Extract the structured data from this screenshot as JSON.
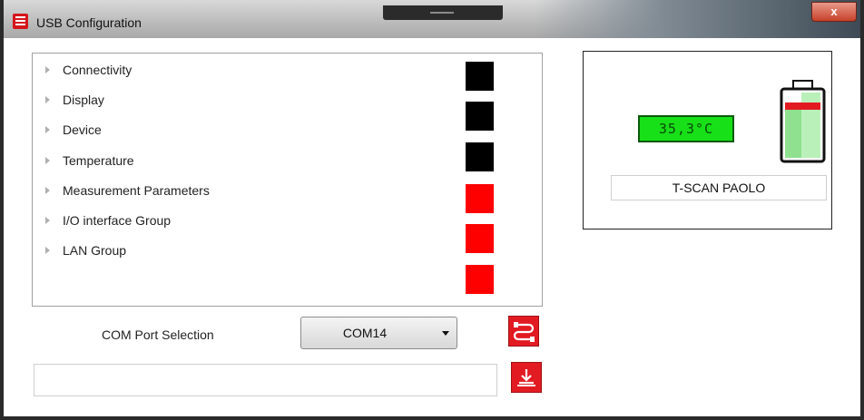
{
  "window": {
    "title": "USB Configuration",
    "close_label": "x"
  },
  "tree": {
    "items": [
      {
        "label": "Connectivity",
        "swatch": "#000000"
      },
      {
        "label": "Display",
        "swatch": "#000000"
      },
      {
        "label": "Device",
        "swatch": "#000000"
      },
      {
        "label": "Temperature",
        "swatch": "#000000"
      },
      {
        "label": "Measurement Parameters",
        "swatch": "#ff0000"
      },
      {
        "label": "I/O interface Group",
        "swatch": "#ff0000"
      },
      {
        "label": "LAN Group",
        "swatch": "#ff0000"
      },
      {
        "label": "",
        "swatch": "#ff0000"
      }
    ]
  },
  "status": {
    "temperature": "35,3°C",
    "battery_level": 0.85,
    "device_name": "T-SCAN PAOLO"
  },
  "com_port": {
    "label": "COM Port Selection",
    "selected": "COM14"
  },
  "path_input": {
    "value": ""
  },
  "colors": {
    "accent_red": "#e21b23",
    "lcd_green": "#18e018"
  }
}
